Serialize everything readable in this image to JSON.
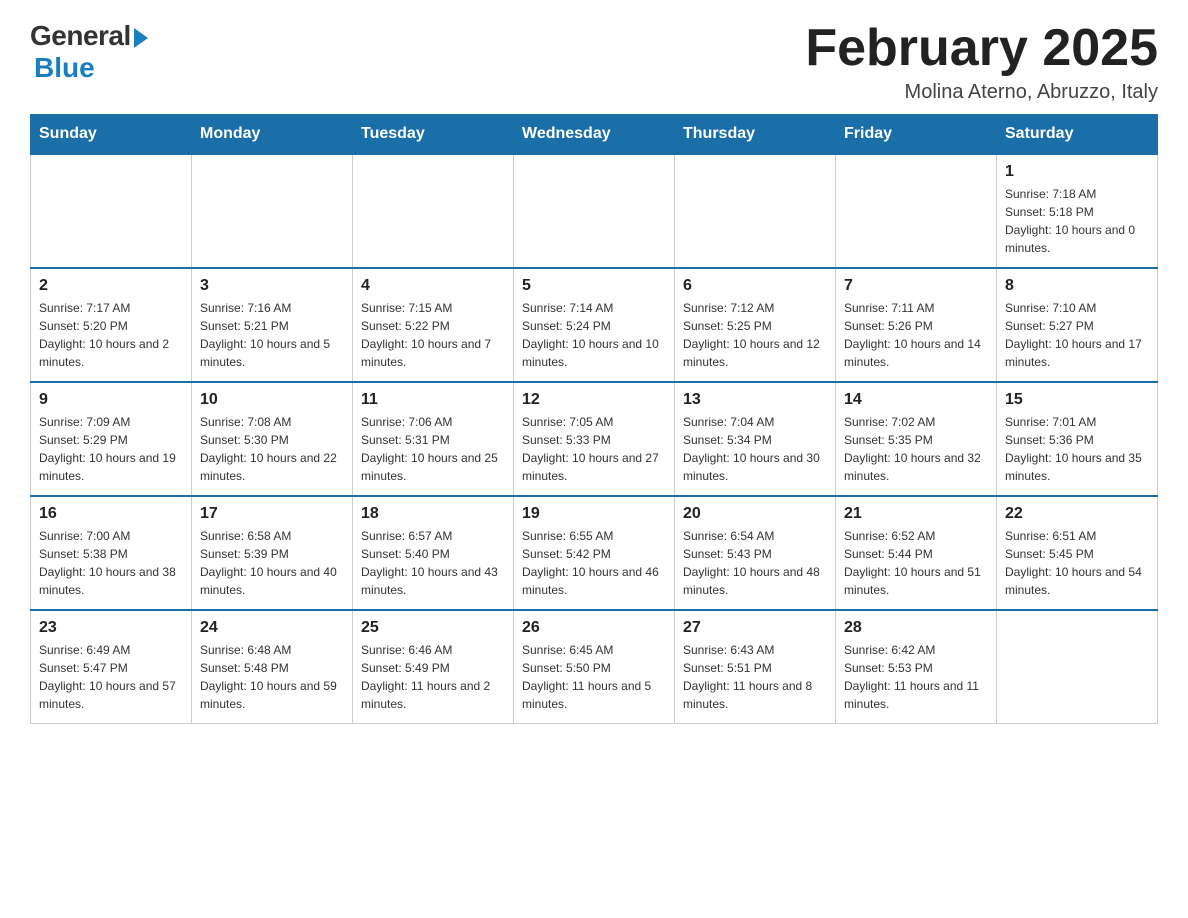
{
  "header": {
    "logo_general": "General",
    "logo_blue": "Blue",
    "month_title": "February 2025",
    "location": "Molina Aterno, Abruzzo, Italy"
  },
  "weekdays": [
    "Sunday",
    "Monday",
    "Tuesday",
    "Wednesday",
    "Thursday",
    "Friday",
    "Saturday"
  ],
  "weeks": [
    {
      "days": [
        {
          "num": "",
          "info": ""
        },
        {
          "num": "",
          "info": ""
        },
        {
          "num": "",
          "info": ""
        },
        {
          "num": "",
          "info": ""
        },
        {
          "num": "",
          "info": ""
        },
        {
          "num": "",
          "info": ""
        },
        {
          "num": "1",
          "info": "Sunrise: 7:18 AM\nSunset: 5:18 PM\nDaylight: 10 hours and 0 minutes."
        }
      ]
    },
    {
      "days": [
        {
          "num": "2",
          "info": "Sunrise: 7:17 AM\nSunset: 5:20 PM\nDaylight: 10 hours and 2 minutes."
        },
        {
          "num": "3",
          "info": "Sunrise: 7:16 AM\nSunset: 5:21 PM\nDaylight: 10 hours and 5 minutes."
        },
        {
          "num": "4",
          "info": "Sunrise: 7:15 AM\nSunset: 5:22 PM\nDaylight: 10 hours and 7 minutes."
        },
        {
          "num": "5",
          "info": "Sunrise: 7:14 AM\nSunset: 5:24 PM\nDaylight: 10 hours and 10 minutes."
        },
        {
          "num": "6",
          "info": "Sunrise: 7:12 AM\nSunset: 5:25 PM\nDaylight: 10 hours and 12 minutes."
        },
        {
          "num": "7",
          "info": "Sunrise: 7:11 AM\nSunset: 5:26 PM\nDaylight: 10 hours and 14 minutes."
        },
        {
          "num": "8",
          "info": "Sunrise: 7:10 AM\nSunset: 5:27 PM\nDaylight: 10 hours and 17 minutes."
        }
      ]
    },
    {
      "days": [
        {
          "num": "9",
          "info": "Sunrise: 7:09 AM\nSunset: 5:29 PM\nDaylight: 10 hours and 19 minutes."
        },
        {
          "num": "10",
          "info": "Sunrise: 7:08 AM\nSunset: 5:30 PM\nDaylight: 10 hours and 22 minutes."
        },
        {
          "num": "11",
          "info": "Sunrise: 7:06 AM\nSunset: 5:31 PM\nDaylight: 10 hours and 25 minutes."
        },
        {
          "num": "12",
          "info": "Sunrise: 7:05 AM\nSunset: 5:33 PM\nDaylight: 10 hours and 27 minutes."
        },
        {
          "num": "13",
          "info": "Sunrise: 7:04 AM\nSunset: 5:34 PM\nDaylight: 10 hours and 30 minutes."
        },
        {
          "num": "14",
          "info": "Sunrise: 7:02 AM\nSunset: 5:35 PM\nDaylight: 10 hours and 32 minutes."
        },
        {
          "num": "15",
          "info": "Sunrise: 7:01 AM\nSunset: 5:36 PM\nDaylight: 10 hours and 35 minutes."
        }
      ]
    },
    {
      "days": [
        {
          "num": "16",
          "info": "Sunrise: 7:00 AM\nSunset: 5:38 PM\nDaylight: 10 hours and 38 minutes."
        },
        {
          "num": "17",
          "info": "Sunrise: 6:58 AM\nSunset: 5:39 PM\nDaylight: 10 hours and 40 minutes."
        },
        {
          "num": "18",
          "info": "Sunrise: 6:57 AM\nSunset: 5:40 PM\nDaylight: 10 hours and 43 minutes."
        },
        {
          "num": "19",
          "info": "Sunrise: 6:55 AM\nSunset: 5:42 PM\nDaylight: 10 hours and 46 minutes."
        },
        {
          "num": "20",
          "info": "Sunrise: 6:54 AM\nSunset: 5:43 PM\nDaylight: 10 hours and 48 minutes."
        },
        {
          "num": "21",
          "info": "Sunrise: 6:52 AM\nSunset: 5:44 PM\nDaylight: 10 hours and 51 minutes."
        },
        {
          "num": "22",
          "info": "Sunrise: 6:51 AM\nSunset: 5:45 PM\nDaylight: 10 hours and 54 minutes."
        }
      ]
    },
    {
      "days": [
        {
          "num": "23",
          "info": "Sunrise: 6:49 AM\nSunset: 5:47 PM\nDaylight: 10 hours and 57 minutes."
        },
        {
          "num": "24",
          "info": "Sunrise: 6:48 AM\nSunset: 5:48 PM\nDaylight: 10 hours and 59 minutes."
        },
        {
          "num": "25",
          "info": "Sunrise: 6:46 AM\nSunset: 5:49 PM\nDaylight: 11 hours and 2 minutes."
        },
        {
          "num": "26",
          "info": "Sunrise: 6:45 AM\nSunset: 5:50 PM\nDaylight: 11 hours and 5 minutes."
        },
        {
          "num": "27",
          "info": "Sunrise: 6:43 AM\nSunset: 5:51 PM\nDaylight: 11 hours and 8 minutes."
        },
        {
          "num": "28",
          "info": "Sunrise: 6:42 AM\nSunset: 5:53 PM\nDaylight: 11 hours and 11 minutes."
        },
        {
          "num": "",
          "info": ""
        }
      ]
    }
  ]
}
